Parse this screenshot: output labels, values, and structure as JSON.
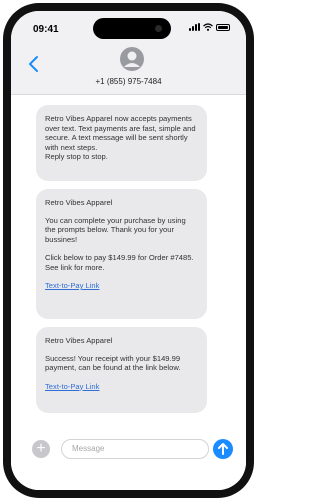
{
  "status_bar": {
    "time": "09:41"
  },
  "header": {
    "contact_number": "+1 (855) 975-7484"
  },
  "messages": [
    {
      "paragraphs": [
        "Retro Vibes Apparel now accepts payments over text. Text payments are fast, simple and secure. A text message will be sent shortly with next steps.\nReply stop to stop."
      ]
    },
    {
      "sender": "Retro Vibes Apparel",
      "paragraphs": [
        "You can complete your purchase by using the prompts below. Thank you for your bussines!",
        "Click below to pay $149.99 for Order #7485. See link for more."
      ],
      "link": "Text-to-Pay Link"
    },
    {
      "sender": "Retro Vibes Apparel",
      "paragraphs": [
        "Success! Your receipt with your $149.99 payment, can be found at the link below."
      ],
      "link": "Text-to-Pay Link"
    }
  ],
  "composer": {
    "placeholder": "Message"
  },
  "colors": {
    "accent": "#1a8cff",
    "bubble": "#e9e9eb",
    "link": "#2f6fd6"
  }
}
